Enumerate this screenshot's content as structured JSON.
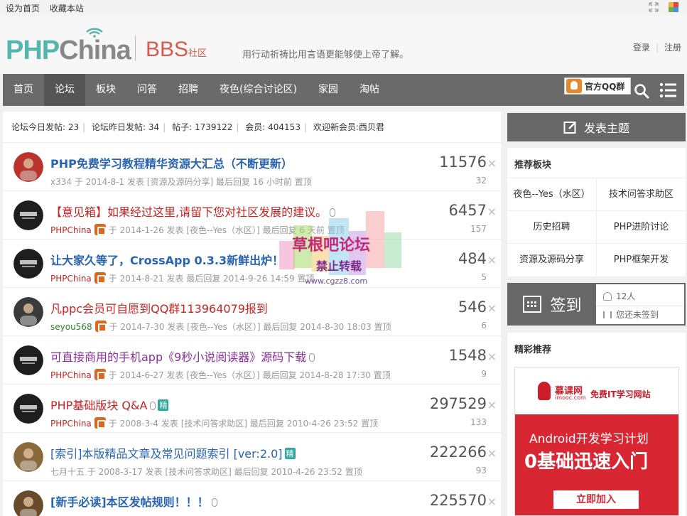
{
  "topbar": {
    "set_home": "设为首页",
    "bookmark": "收藏本站"
  },
  "header": {
    "logo_php": "PHP",
    "logo_china": "China",
    "bbs": "BBS",
    "bbs_sub": "社区",
    "slogan": "用行动祈祷比用言语更能够使上帝了解。",
    "login": "登录",
    "register": "注册"
  },
  "nav": {
    "items": [
      {
        "label": "首页"
      },
      {
        "label": "论坛",
        "active": true
      },
      {
        "label": "板块"
      },
      {
        "label": "问答"
      },
      {
        "label": "招聘"
      },
      {
        "label": "夜色(综合讨论区)"
      },
      {
        "label": "家园"
      },
      {
        "label": "淘帖"
      }
    ],
    "qq_group": "官方QQ群"
  },
  "stats": {
    "today_label": "论坛今日发帖:",
    "today": "23",
    "yesterday_label": "论坛昨日发帖:",
    "yesterday": "34",
    "posts_label": "帖子:",
    "posts": "1739122",
    "members_label": "会员:",
    "members": "404153",
    "welcome_label": "欢迎新会员:",
    "newest": "西贝君"
  },
  "threads": [
    {
      "title": "PHP免费学习教程精华资源大汇总（不断更新）",
      "author": "x334",
      "date": "于 2014-8-1 发表",
      "forum": "[资源及源码分享]",
      "last": "最后回复 16 小时前",
      "top": "置顶",
      "views": "11576",
      "replies": "32"
    },
    {
      "title": "【意见箱】如果经过这里,请留下您对社区发展的建议。",
      "author": "PHPChina",
      "date": "于 2014-1-26 发表",
      "forum": "[夜色--Yes（水区）]",
      "last": "最后回复 6 天前",
      "top": "置顶",
      "views": "6457",
      "replies": "157"
    },
    {
      "title": "让大家久等了，CrossApp 0.3.3新鲜出炉！",
      "author": "PHPChina",
      "date": "于 2014-8-21 发表",
      "forum": "",
      "last": "最后回复 2014-9-26 14:59",
      "top": "置顶",
      "views": "484",
      "replies": "5"
    },
    {
      "title": "凡ppc会员可自愿到QQ群113964079报到",
      "author": "seyou568",
      "date": "于 2014-7-30 发表",
      "forum": "[夜色--Yes（水区）]",
      "last": "最后回复 2014-8-30 18:03",
      "top": "置顶",
      "views": "546",
      "replies": "6"
    },
    {
      "title": "可直接商用的手机app《9秒小说阅读器》源码下载",
      "author": "PHPChina",
      "date": "于 2014-6-27 发表",
      "forum": "[夜色--Yes（水区）]",
      "last": "最后回复 2014-8-28 17:30",
      "top": "置顶",
      "views": "1548",
      "replies": "9"
    },
    {
      "title": "PHP基础版块 Q&A",
      "tag": "精",
      "author": "PHPChina",
      "date": "于 2008-3-4 发表",
      "forum": "[技术问答求助区]",
      "last": "最后回复 2010-4-26 23:52",
      "top": "置顶",
      "views": "297529",
      "replies": "133"
    },
    {
      "title": "[索引]本版精品文章及常见问题索引 [ver:2.0]",
      "tag": "精",
      "author": "七月十五",
      "date": "于 2008-3-17 发表",
      "forum": "[技术问答求助区]",
      "last": "最后回复 2010-4-26 23:52",
      "top": "置顶",
      "views": "222266",
      "replies": "93"
    },
    {
      "title": "[新手必读]本区发帖规则！！！",
      "views": "225570"
    }
  ],
  "watermark": {
    "line1": "草根吧论坛",
    "line2": "禁止转载",
    "line3": "www.cgzz8.com"
  },
  "sidebar": {
    "post_button": "发表主题",
    "recommend_title": "推荐板块",
    "recommend": [
      "夜色--Yes（水区）",
      "技术问答求助区",
      "历史招聘",
      "PHP进阶讨论",
      "资源及源码分享",
      "PHP框架开发"
    ],
    "signin_label": "签到",
    "signin_count": "12人",
    "signin_status": "您还未签到",
    "featured_title": "精彩推荐",
    "ad": {
      "brand": "慕课网",
      "brand_sub": "imooc.com",
      "free": "免费IT学习网站",
      "line1": "Android开发学习计划",
      "line2": "0基础迅速入门",
      "button": "立即加入"
    }
  },
  "colors": {
    "accent": "#55b6ad",
    "nav_bg": "#6a6a6a",
    "title_blue": "#2a64b0",
    "title_red": "#cc2222",
    "title_purple": "#8a2e9c",
    "bbs_red": "#d55a4f"
  }
}
